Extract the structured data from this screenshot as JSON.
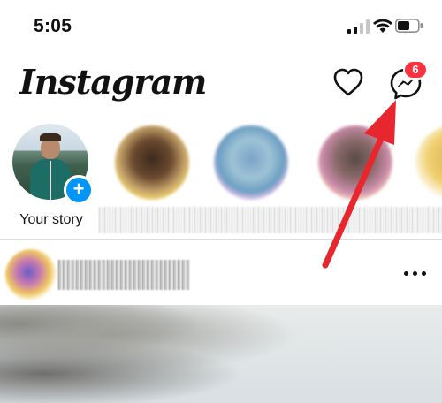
{
  "status_bar": {
    "time": "5:05"
  },
  "header": {
    "logo": "Instagram",
    "messages_badge": "6"
  },
  "stories": {
    "own_label": "Your story",
    "add_glyph": "+"
  },
  "icons": {
    "heart": "heart-icon",
    "messenger": "messenger-icon",
    "more": "more-horizontal-icon",
    "add": "plus-icon"
  },
  "colors": {
    "accent": "#0095f6",
    "badge": "#ff3040",
    "arrow": "#e8262d"
  }
}
